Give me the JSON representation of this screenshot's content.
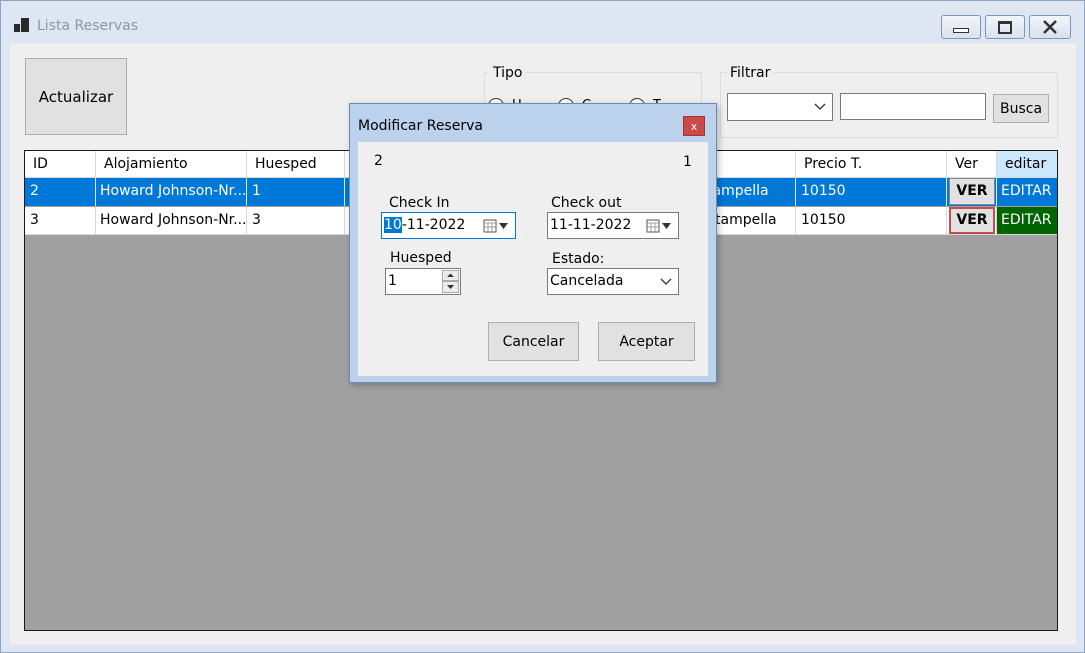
{
  "window": {
    "title": "Lista Reservas"
  },
  "toolbar": {
    "actualizar_label": "Actualizar"
  },
  "tipo": {
    "group_label": "Tipo",
    "options": [
      "H",
      "C",
      "T"
    ]
  },
  "filtrar": {
    "group_label": "Filtrar",
    "select_value": "",
    "input_value": "",
    "busca_label": "Busca"
  },
  "grid": {
    "columns": [
      "ID",
      "Alojamiento",
      "Huesped",
      "",
      "",
      "Precio T.",
      "Ver",
      "editar"
    ],
    "rows": [
      {
        "id": "2",
        "alojamiento": "Howard Johnson-Nr...",
        "huesped": "1",
        "hidden_col": "tampella",
        "precio": "10150",
        "ver": "VER",
        "editar": "EDITAR"
      },
      {
        "id": "3",
        "alojamiento": "Howard Johnson-Nr...",
        "huesped": "3",
        "hidden_col": "tampella",
        "precio": "10150",
        "ver": "VER",
        "editar": "EDITAR"
      }
    ]
  },
  "dialog": {
    "title": "Modificar Reserva",
    "close_label": "x",
    "reserva_id": "2",
    "right_number": "1",
    "check_in_label": "Check In",
    "check_in_day": "10",
    "check_in_rest": "-11-2022",
    "check_out_label": "Check out",
    "check_out_value": "11-11-2022",
    "huesped_label": "Huesped",
    "huesped_value": "1",
    "estado_label": "Estado:",
    "estado_value": "Cancelada",
    "cancel_label": "Cancelar",
    "accept_label": "Aceptar"
  },
  "colors": {
    "selection": "#0078d7",
    "editar_green": "#006400",
    "grid_bg": "#a0a0a0"
  }
}
